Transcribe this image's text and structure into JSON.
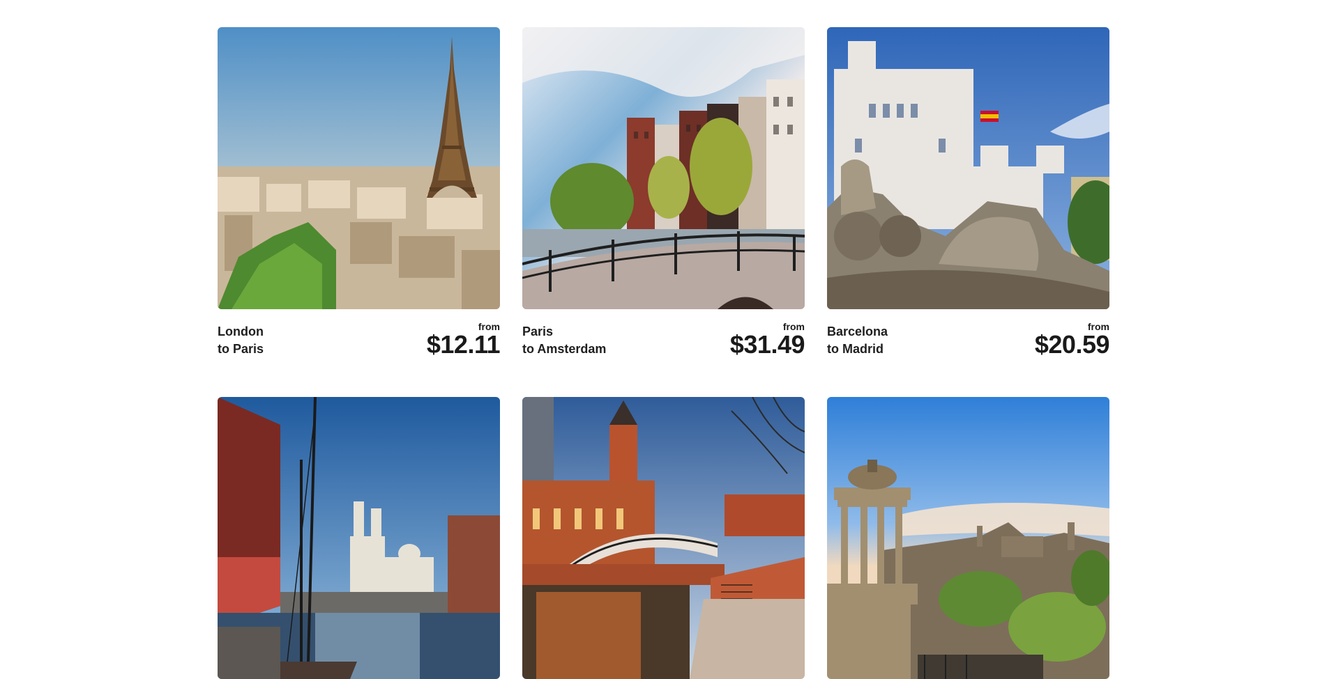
{
  "deals": [
    {
      "origin": "London",
      "destination": "to Paris",
      "from_label": "from",
      "price": "$12.11",
      "image": "eiffel-tower-photo"
    },
    {
      "origin": "Paris",
      "destination": "to Amsterdam",
      "from_label": "from",
      "price": "$31.49",
      "image": "amsterdam-canal-photo"
    },
    {
      "origin": "Barcelona",
      "destination": "to Madrid",
      "from_label": "from",
      "price": "$20.59",
      "image": "madrid-cibeles-photo"
    },
    {
      "origin": "",
      "destination": "",
      "from_label": "",
      "price": "",
      "image": "liverpool-docks-photo"
    },
    {
      "origin": "",
      "destination": "",
      "from_label": "",
      "price": "",
      "image": "manchester-canal-photo"
    },
    {
      "origin": "",
      "destination": "",
      "from_label": "",
      "price": "",
      "image": "edinburgh-calton-hill-photo"
    }
  ]
}
